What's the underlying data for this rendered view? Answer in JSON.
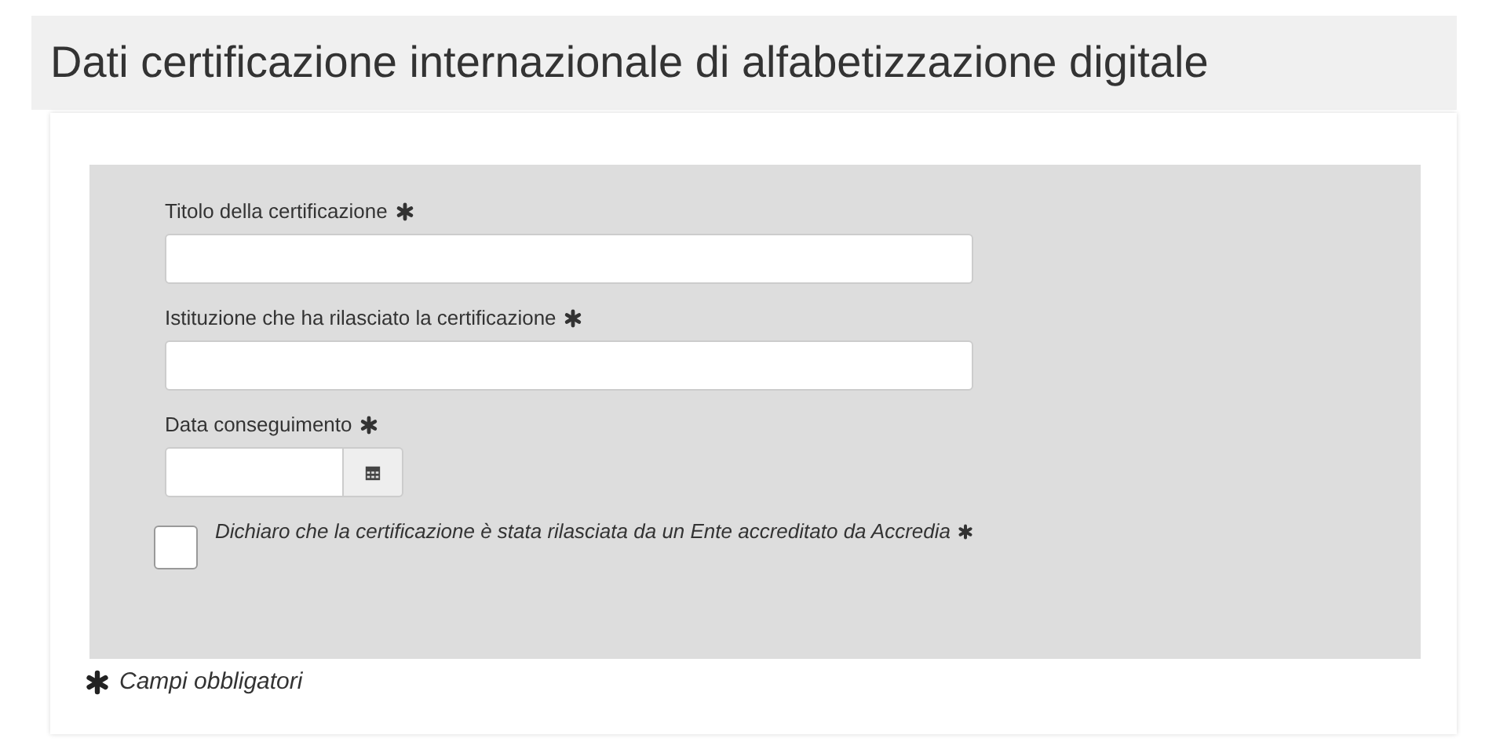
{
  "title": "Dati certificazione internazionale di alfabetizzazione digitale",
  "fields": [
    {
      "kind": "text",
      "label": "Titolo della certificazione",
      "required": true
    },
    {
      "kind": "text",
      "label": "Istituzione che ha rilasciato la certificazione",
      "required": true
    },
    {
      "kind": "date",
      "label": "Data conseguimento",
      "required": true
    }
  ],
  "declaration": {
    "text": "Dichiaro che la certificazione è stata rilasciata da un Ente accreditato da Accredia",
    "checked": false,
    "required": true
  },
  "legend": "Campi obbligatori"
}
